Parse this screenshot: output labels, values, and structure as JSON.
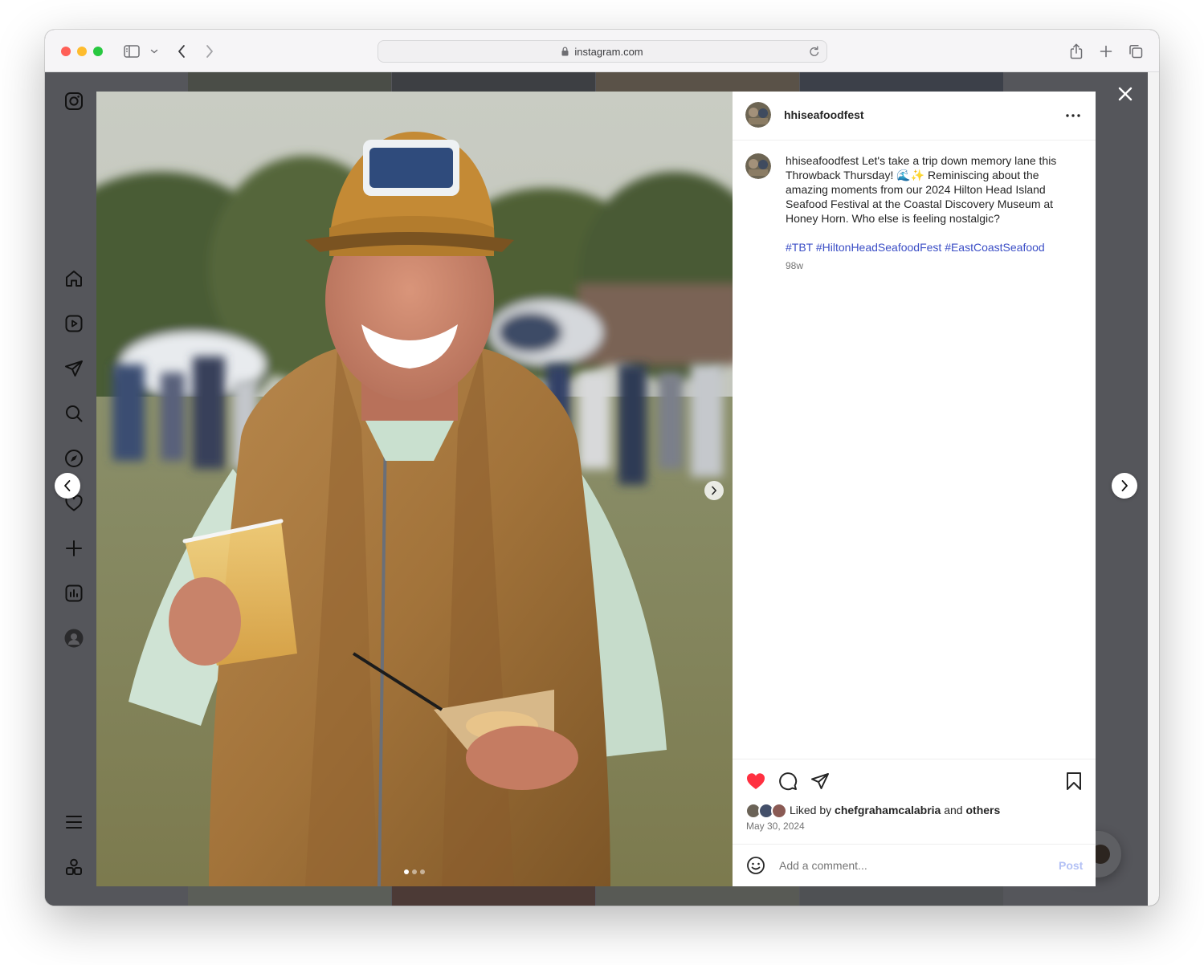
{
  "browser": {
    "url": "instagram.com",
    "colors": {
      "close": "#ff5f57",
      "minimize": "#febc2e",
      "zoom": "#28c840"
    },
    "toolbar_icons": [
      "sidebar-toggle-icon",
      "chevron-down-icon",
      "back-icon",
      "forward-icon",
      "reload-icon",
      "share-icon",
      "new-tab-icon",
      "tabs-overview-icon"
    ]
  },
  "sidebar": {
    "logo": "instagram-icon",
    "items": [
      {
        "icon": "home-icon"
      },
      {
        "icon": "reels-icon"
      },
      {
        "icon": "messages-icon"
      },
      {
        "icon": "search-icon"
      },
      {
        "icon": "explore-icon"
      },
      {
        "icon": "notifications-icon"
      },
      {
        "icon": "create-icon"
      },
      {
        "icon": "dashboard-icon"
      },
      {
        "icon": "profile-avatar"
      }
    ],
    "bottom": [
      {
        "icon": "more-menu-icon"
      },
      {
        "icon": "also-from-meta-icon"
      }
    ]
  },
  "modal": {
    "close_icon": "close-icon",
    "prev_icon": "chevron-left-icon",
    "next_icon": "chevron-right-icon",
    "carousel": {
      "dots": 3,
      "active": 1,
      "next_icon": "chevron-right-icon"
    }
  },
  "post": {
    "username": "hhiseafoodfest",
    "more_icon": "more-horizontal-icon",
    "caption_user": "hhiseafoodfest",
    "caption_text": " Let's take a trip down memory lane this Throwback Thursday! 🌊✨ Reminiscing about the amazing moments from our 2024 Hilton Head Island Seafood Festival at the Coastal Discovery Museum at Honey Horn. Who else is feeling nostalgic?",
    "hashtags": "#TBT #HiltonHeadSeafoodFest #EastCoastSeafood",
    "age": "98w",
    "liked": true,
    "like_color": "#ff3040",
    "liked_by_prefix": "Liked by ",
    "liked_by_user": "chefgrahamcalabria",
    "liked_by_and": " and ",
    "liked_by_others": "others",
    "date": "May 30, 2024",
    "comment_placeholder": "Add a comment...",
    "post_label": "Post",
    "post_color": "#b3c1f5"
  }
}
